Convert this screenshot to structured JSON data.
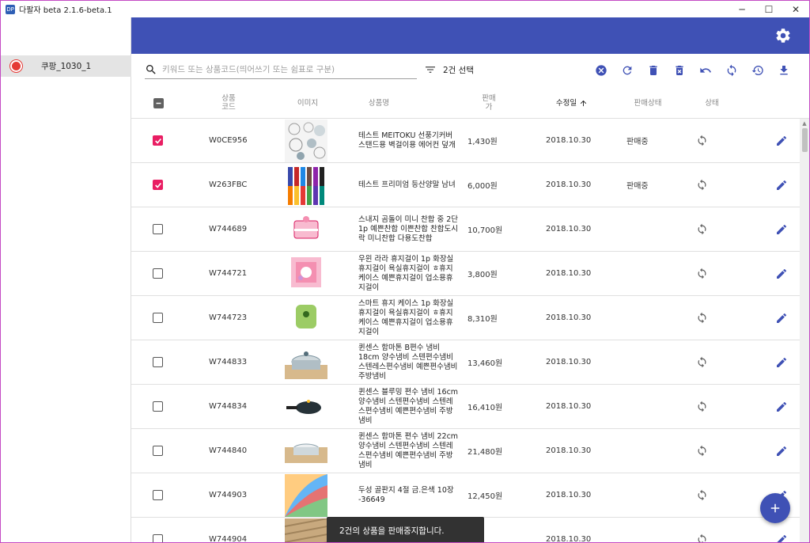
{
  "window": {
    "title": "다팔자 beta 2.1.6-beta.1",
    "icon_text": "DP",
    "controls": [
      "─",
      "☐",
      "✕"
    ]
  },
  "sidebar": {
    "items": [
      {
        "label": "쿠팡_1030_1",
        "selected": true,
        "logo_color": "#e53935"
      }
    ]
  },
  "appbar": {
    "color": "#3f51b5",
    "settings_icon": "gear-icon"
  },
  "toolbar": {
    "search_placeholder": "키워드 또는 상품코드(띄어쓰기 또는 쉼표로 구분)",
    "search_value": "",
    "selection_text": "2건 선택",
    "actions": [
      "cancel-circle-icon",
      "refresh-icon",
      "delete-icon",
      "delete-forever-icon",
      "undo-icon",
      "sync-icon",
      "history-icon",
      "download-icon"
    ]
  },
  "table": {
    "headers": {
      "code": "상품\n코드",
      "image": "이미지",
      "name": "상품명",
      "price": "판매\n가",
      "date": "수정일",
      "sale_status": "판매상태",
      "status": "상태"
    },
    "sort": {
      "column": "date",
      "direction": "asc"
    },
    "rows": [
      {
        "checked": true,
        "code": "W0CE956",
        "name": "테스트 MEITOKU 선풍기커버 스탠드용 벽걸이용 에어컨 덮개",
        "price": "1,430원",
        "date": "2018.10.30",
        "sale_status": "판매중"
      },
      {
        "checked": true,
        "code": "W263FBC",
        "name": "테스트 프리미엄 등산양말 남녀",
        "price": "6,000원",
        "date": "2018.10.30",
        "sale_status": "판매중"
      },
      {
        "checked": false,
        "code": "W744689",
        "name": "스내지 곰돌이 미니 찬합 중 2단 1p 예쁜찬합 이쁜찬합 찬합도시락 미니찬합 다용도찬합",
        "price": "10,700원",
        "date": "2018.10.30",
        "sale_status": ""
      },
      {
        "checked": false,
        "code": "W744721",
        "name": "우윈 라라 휴지걸이 1p 화장실휴지걸이 욕실휴지걸이 ㅎ휴지케이스 예쁜휴지걸이 업소용휴지걸이",
        "price": "3,800원",
        "date": "2018.10.30",
        "sale_status": ""
      },
      {
        "checked": false,
        "code": "W744723",
        "name": "스마트 휴지 케이스 1p 화장실휴지걸이 욕실휴지걸이 ㅎ휴지케이스 예쁜휴지걸이 업소용휴지걸이",
        "price": "8,310원",
        "date": "2018.10.30",
        "sale_status": ""
      },
      {
        "checked": false,
        "code": "W744833",
        "name": "퀸센스 함마톤 B편수 냄비 18cm 양수냄비 스텐편수냄비 스텐레스편수냄비 예쁜편수냄비 주방냄비",
        "price": "13,460원",
        "date": "2018.10.30",
        "sale_status": ""
      },
      {
        "checked": false,
        "code": "W744834",
        "name": "퀸센스 블루밍 편수 냄비 16cm 양수냄비 스텐편수냄비 스텐레스편수냄비 예쁜편수냄비 주방냄비",
        "price": "16,410원",
        "date": "2018.10.30",
        "sale_status": ""
      },
      {
        "checked": false,
        "code": "W744840",
        "name": "퀸센스 함마톤 편수 냄비 22cm 양수냄비 스텐편수냄비 스텐레스편수냄비 예쁜편수냄비 주방냄비",
        "price": "21,480원",
        "date": "2018.10.30",
        "sale_status": ""
      },
      {
        "checked": false,
        "code": "W744903",
        "name": "두성 골판지 4절 금.은색 10장 -36649",
        "price": "12,450원",
        "date": "2018.10.30",
        "sale_status": ""
      },
      {
        "checked": false,
        "code": "W744904",
        "name": "",
        "price": "",
        "date": "2018.10.30",
        "sale_status": ""
      }
    ]
  },
  "snackbar": {
    "message": "2건의 상품을 판매중지합니다."
  },
  "fab": {
    "icon": "add-icon"
  }
}
